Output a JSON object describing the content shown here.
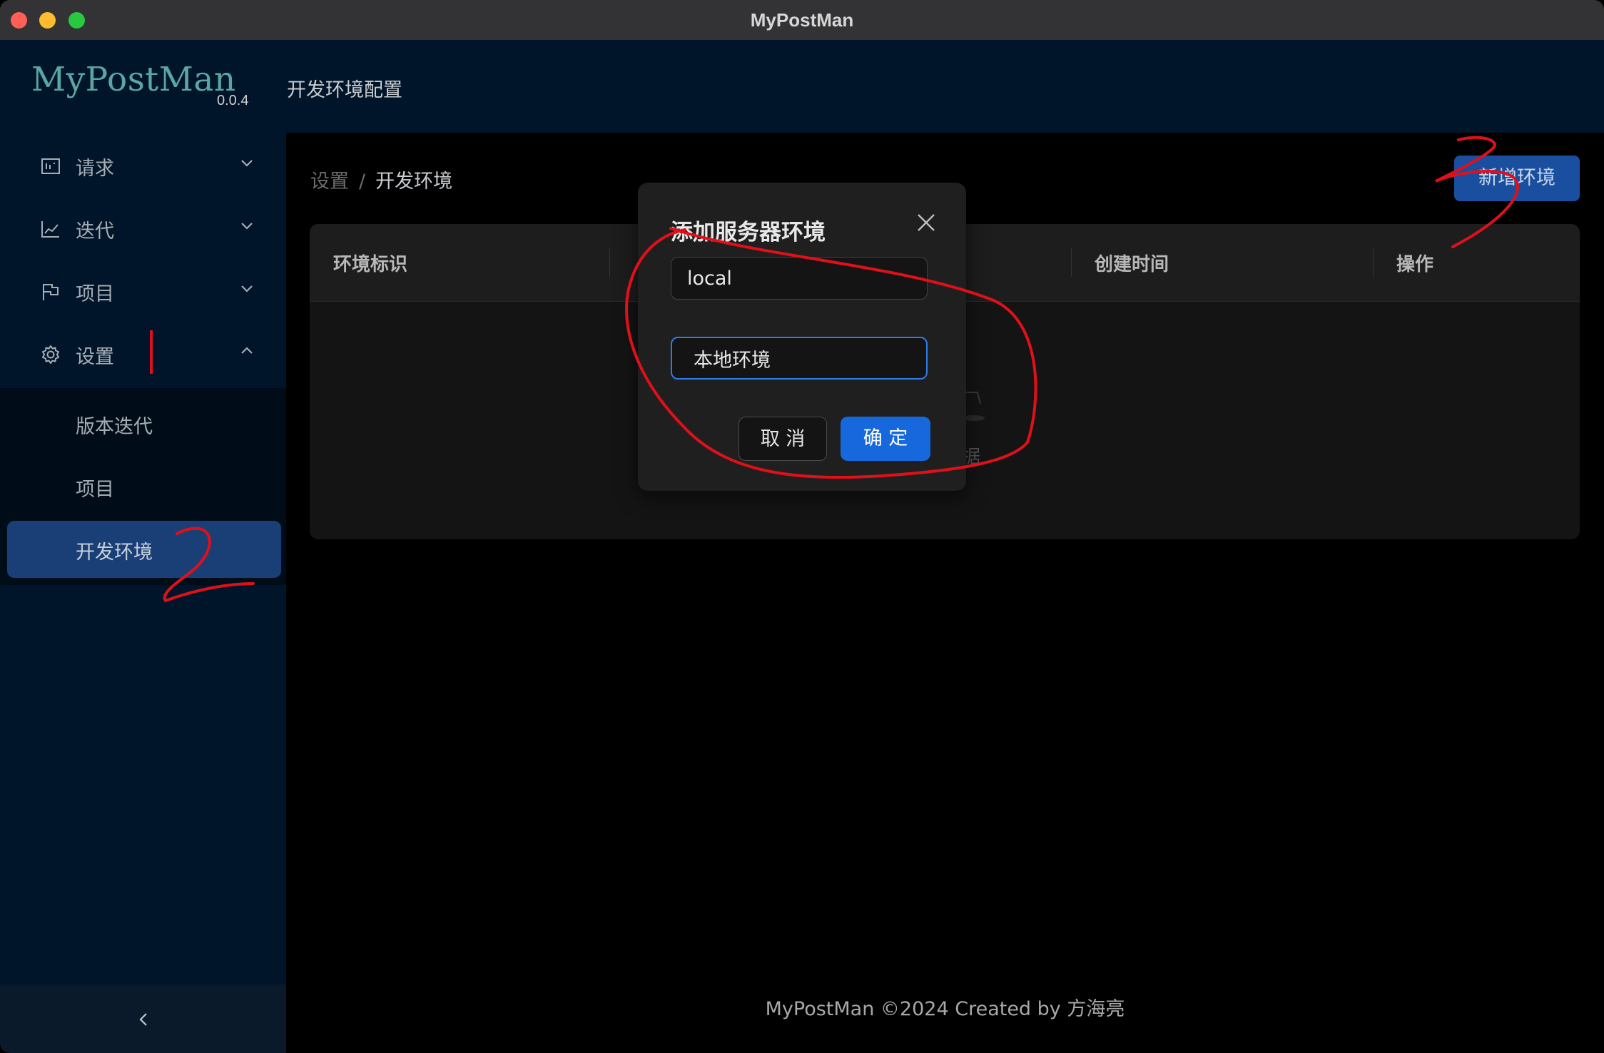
{
  "window": {
    "title": "MyPostMan"
  },
  "sidebar": {
    "logo": "MyPostMan",
    "version": "0.0.4",
    "menu": [
      {
        "label": "请求",
        "icon": "request-icon",
        "expanded": false
      },
      {
        "label": "迭代",
        "icon": "chart-line-icon",
        "expanded": false
      },
      {
        "label": "项目",
        "icon": "flag-icon",
        "expanded": false
      },
      {
        "label": "设置",
        "icon": "gear-icon",
        "expanded": true
      }
    ],
    "submenu": [
      {
        "label": "版本迭代"
      },
      {
        "label": "项目"
      },
      {
        "label": "开发环境",
        "active": true
      }
    ],
    "collapse_icon": "chevron-left-icon"
  },
  "header": {
    "title": "开发环境配置"
  },
  "breadcrumb": {
    "items": [
      "设置",
      "开发环境"
    ],
    "separator": "/"
  },
  "toolbar": {
    "add_label": "新增环境"
  },
  "table": {
    "columns": [
      "环境标识",
      "",
      "创建时间",
      "操作"
    ],
    "empty_text": "据"
  },
  "footer": {
    "text": "MyPostMan ©2024 Created by 方海亮"
  },
  "modal": {
    "title": "添加服务器环境",
    "field1_value": "local",
    "field2_value": "本地环境",
    "cancel_label": "取 消",
    "ok_label": "确 定"
  },
  "colors": {
    "sidebar_bg": "#001529",
    "primary": "#1668dc",
    "active_menu": "#1a3f77",
    "annotation": "#e0101a"
  }
}
